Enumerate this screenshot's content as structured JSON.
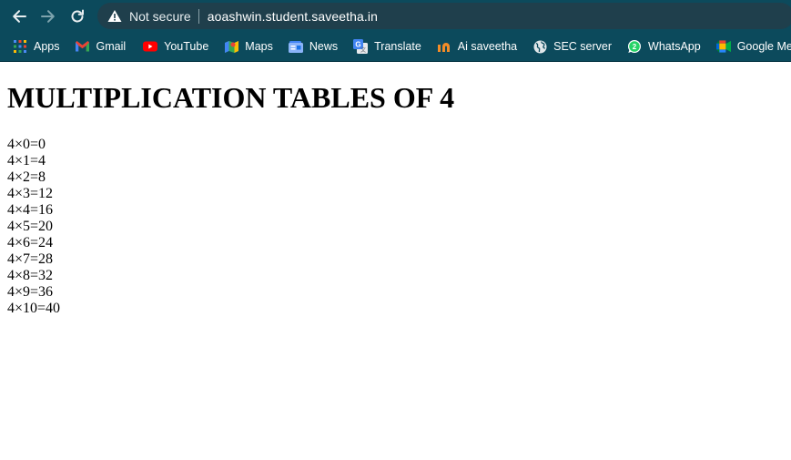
{
  "browser": {
    "security_label": "Not secure",
    "url": "aoashwin.student.saveetha.in",
    "theme_color": "#0c4a5c"
  },
  "bookmarks": [
    {
      "label": "Apps",
      "icon": "apps-grid-icon"
    },
    {
      "label": "Gmail",
      "icon": "gmail-icon"
    },
    {
      "label": "YouTube",
      "icon": "youtube-icon"
    },
    {
      "label": "Maps",
      "icon": "maps-icon"
    },
    {
      "label": "News",
      "icon": "news-icon"
    },
    {
      "label": "Translate",
      "icon": "translate-icon"
    },
    {
      "label": "Ai saveetha",
      "icon": "ai-saveetha-icon"
    },
    {
      "label": "SEC server",
      "icon": "globe-icon"
    },
    {
      "label": "WhatsApp",
      "icon": "whatsapp-icon"
    },
    {
      "label": "Google Meet",
      "icon": "google-meet-icon"
    }
  ],
  "page": {
    "heading": "MULTIPLICATION TABLES OF 4",
    "lines": [
      "4×0=0",
      "4×1=4",
      "4×2=8",
      "4×3=12",
      "4×4=16",
      "4×5=20",
      "4×6=24",
      "4×7=28",
      "4×8=32",
      "4×9=36",
      "4×10=40"
    ]
  }
}
